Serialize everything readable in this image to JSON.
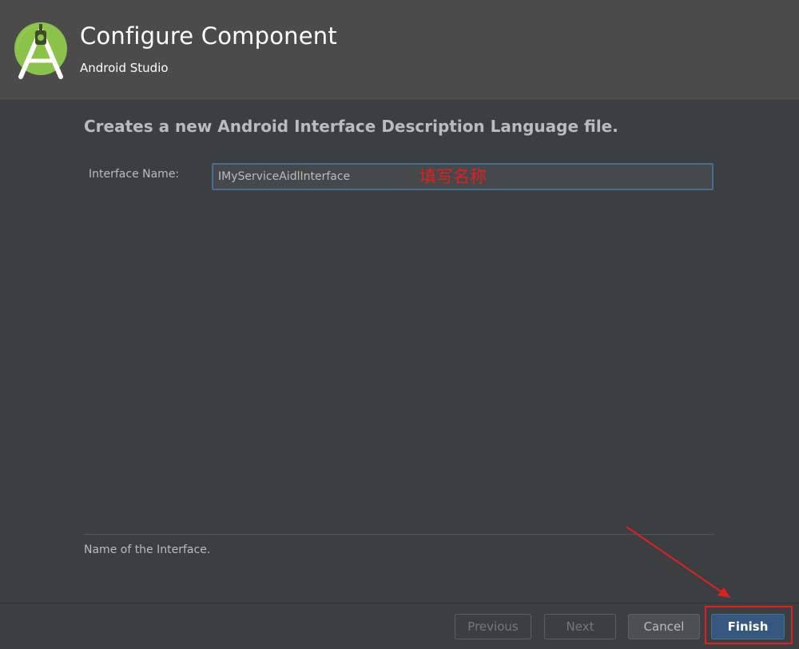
{
  "header": {
    "title": "Configure Component",
    "subtitle": "Android Studio",
    "logo_icon": "android-studio-icon"
  },
  "main": {
    "description": "Creates a new Android Interface Description Language file.",
    "interface_name": {
      "label": "Interface Name:",
      "value": "IMyServiceAidlInterface"
    },
    "hint": "Name of the Interface."
  },
  "annotation": {
    "text": "填写名称",
    "color": "#e02020"
  },
  "footer": {
    "previous_label": "Previous",
    "next_label": "Next",
    "cancel_label": "Cancel",
    "finish_label": "Finish"
  },
  "colors": {
    "background": "#3c3f41",
    "header_background": "#4b4b4b",
    "primary_button": "#365880",
    "logo_green": "#8bc34a"
  }
}
